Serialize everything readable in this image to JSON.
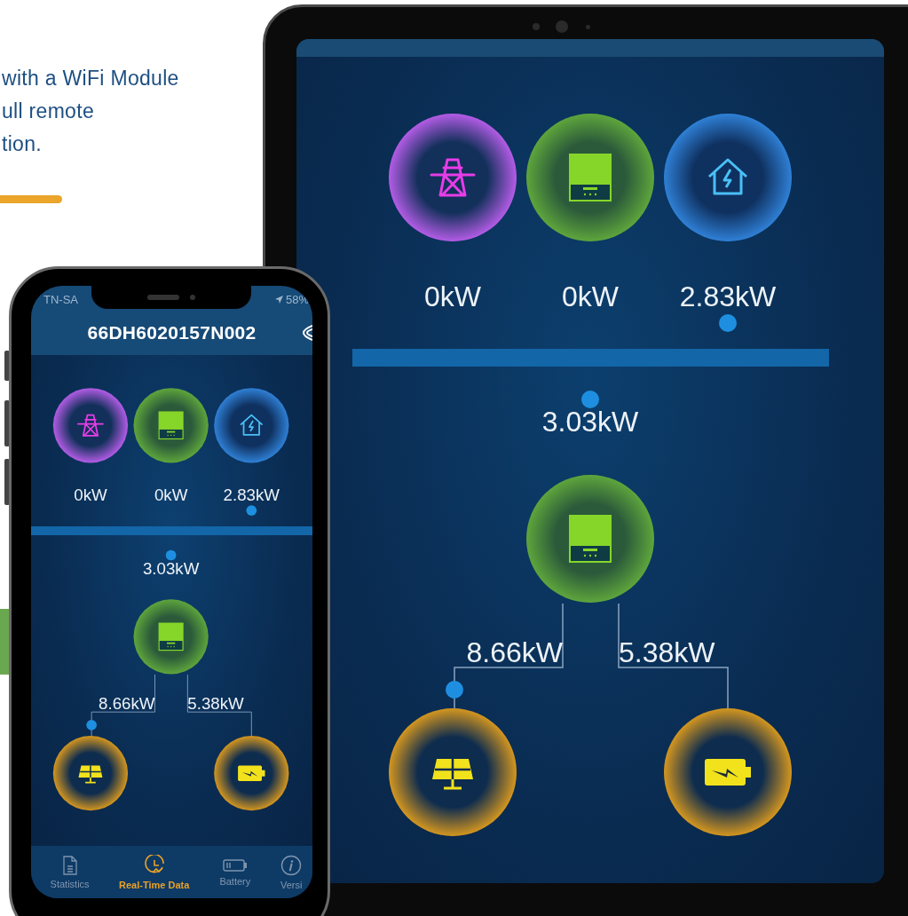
{
  "promo": {
    "lines": [
      "with a WiFi Module",
      "ull remote",
      "tion."
    ]
  },
  "tablet": {
    "flow": {
      "top_nodes": [
        {
          "kind": "grid",
          "value": "0kW"
        },
        {
          "kind": "inverter",
          "value": "0kW"
        },
        {
          "kind": "home",
          "value": "2.83kW"
        }
      ],
      "center": {
        "kind": "inverter",
        "value": "3.03kW"
      },
      "branches": [
        {
          "kind": "solar",
          "value": "8.66kW"
        },
        {
          "kind": "battery",
          "value": "5.38kW"
        }
      ]
    }
  },
  "phone": {
    "status_bar": {
      "carrier": "TN-SA",
      "battery": "58%"
    },
    "title": "66DH6020157N002",
    "flow": {
      "top_nodes": [
        {
          "kind": "grid",
          "value": "0kW"
        },
        {
          "kind": "inverter",
          "value": "0kW"
        },
        {
          "kind": "home",
          "value": "2.83kW"
        }
      ],
      "center": {
        "kind": "inverter",
        "value": "3.03kW"
      },
      "branches": [
        {
          "kind": "solar",
          "value": "8.66kW"
        },
        {
          "kind": "battery",
          "value": "5.38kW"
        }
      ]
    },
    "tabs": [
      {
        "kind": "document",
        "label": "Statistics",
        "selected": false
      },
      {
        "kind": "clock",
        "label": "Real-Time Data",
        "selected": true
      },
      {
        "kind": "battery",
        "label": "Battery",
        "selected": false
      },
      {
        "kind": "info",
        "label": "Versi",
        "selected": false
      }
    ]
  }
}
